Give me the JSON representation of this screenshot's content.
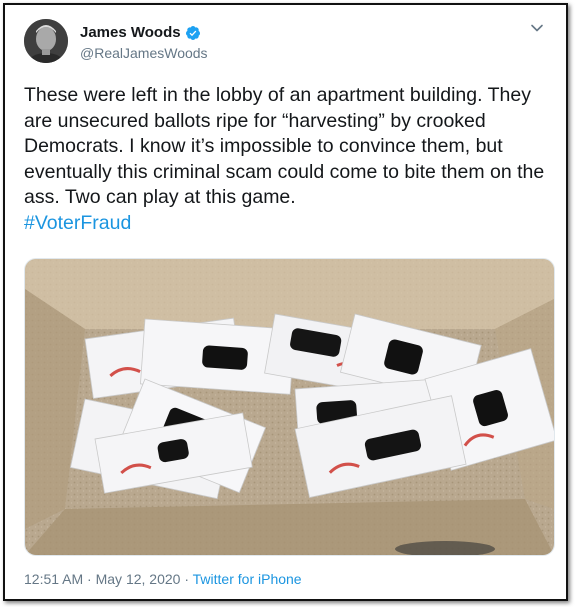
{
  "author": {
    "name": "James Woods",
    "handle": "@RealJamesWoods",
    "verified_icon": "verified-badge-icon",
    "avatar_icon": "profile-photo"
  },
  "tweet": {
    "text": "These were left in the lobby of an apartment building. They are unsecured ballots ripe for “harvesting” by crooked Democrats. I know it’s impossible to convince them, but eventually this criminal scam could come to bite them on the ass. Two can play at this game.",
    "hashtag": "#VoterFraud"
  },
  "media": {
    "description_icon": "photo-of-ballot-envelopes"
  },
  "meta": {
    "time": "12:51 AM",
    "separator": "·",
    "date": "May 12, 2020",
    "source": "Twitter for iPhone"
  },
  "colors": {
    "link": "#1b95e0",
    "verified": "#1da1f2",
    "text": "#14171a",
    "secondary": "#657786"
  }
}
